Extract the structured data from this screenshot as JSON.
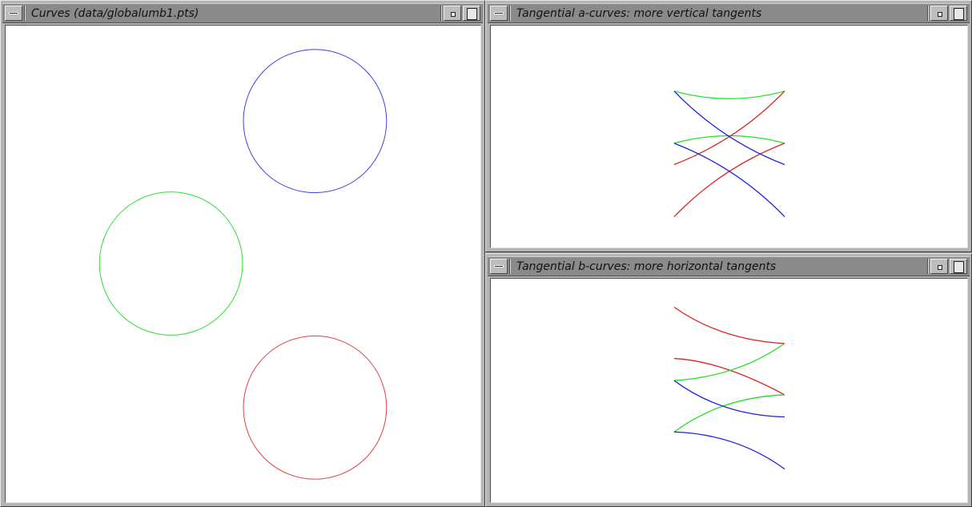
{
  "windows": {
    "curves": {
      "title": "Curves (data/globalumb1.pts)",
      "circles": [
        {
          "name": "blue-circle",
          "color": "#4040e0"
        },
        {
          "name": "green-circle",
          "color": "#30e030"
        },
        {
          "name": "red-circle",
          "color": "#e04040"
        }
      ]
    },
    "a_curves": {
      "title": "Tangential a-curves: more vertical tangents"
    },
    "b_curves": {
      "title": "Tangential b-curves: more horizontal tangents"
    }
  },
  "colors": {
    "red": "#e02020",
    "green": "#20e020",
    "blue": "#2020e0"
  }
}
